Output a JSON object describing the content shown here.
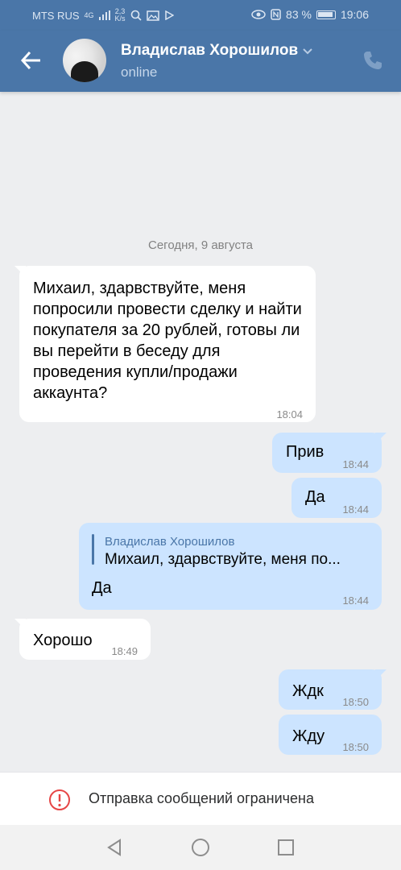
{
  "status_bar": {
    "carrier": "MTS RUS",
    "net_gen": "4G",
    "speed_value": "2,3",
    "speed_unit": "K/s",
    "battery": "83 %",
    "time": "19:06"
  },
  "header": {
    "contact_name": "Владислав Хорошилов",
    "status": "online"
  },
  "chat": {
    "date_separator": "Сегодня, 9 августа",
    "messages": [
      {
        "text": "Михаил, здарвствуйте, меня попросили провести сделку и найти покупателя за 20 рублей, готовы ли вы перейти в беседу для проведения купли/продажи аккаунта?",
        "time": "18:04",
        "direction": "in"
      },
      {
        "text": "Прив",
        "time": "18:44",
        "direction": "out"
      },
      {
        "text": "Да",
        "time": "18:44",
        "direction": "out"
      },
      {
        "reply_name": "Владислав Хорошилов",
        "reply_text": "Михаил, здарвствуйте, меня по...",
        "text": "Да",
        "time": "18:44",
        "direction": "out"
      },
      {
        "text": "Хорошо",
        "time": "18:49",
        "direction": "in"
      },
      {
        "text": "Ждк",
        "time": "18:50",
        "direction": "out"
      },
      {
        "text": "Жду",
        "time": "18:50",
        "direction": "out"
      }
    ]
  },
  "restriction": {
    "text": "Отправка сообщений ограничена"
  },
  "colors": {
    "header": "#4a76a8",
    "outgoing_bubble": "#cce4ff",
    "incoming_bubble": "#ffffff",
    "background": "#edeef0",
    "warning": "#e64646"
  },
  "icons": [
    "back-arrow-icon",
    "chevron-down-icon",
    "phone-icon",
    "warning-icon",
    "nav-back-icon",
    "nav-home-icon",
    "nav-recent-icon"
  ]
}
